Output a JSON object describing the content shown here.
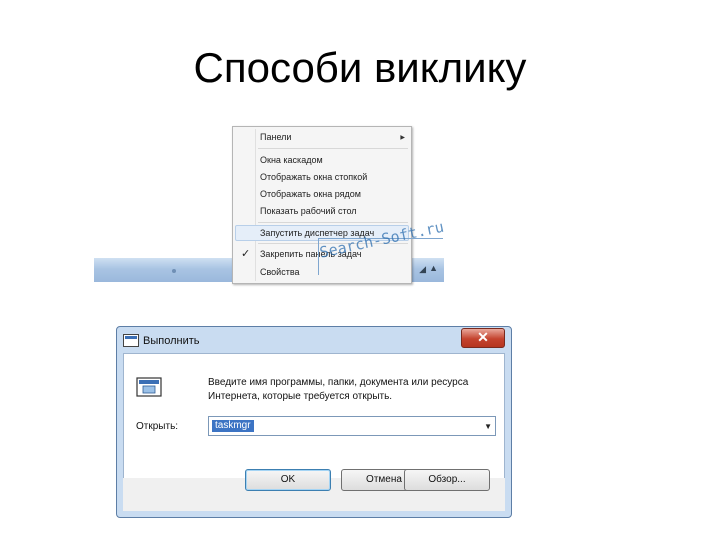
{
  "slide": {
    "title": "Способи виклику"
  },
  "context_menu": {
    "items": [
      {
        "label": "Панели",
        "has_submenu": true
      },
      {
        "label": "Окна каскадом"
      },
      {
        "label": "Отображать окна стопкой"
      },
      {
        "label": "Отображать окна рядом"
      },
      {
        "label": "Показать рабочий стол"
      },
      {
        "label": "Запустить диспетчер задач",
        "highlighted": true
      },
      {
        "label": "Закрепить панель задач",
        "checked": true
      },
      {
        "label": "Свойства"
      }
    ],
    "watermark": "Search-Soft.ru"
  },
  "run_dialog": {
    "title": "Выполнить",
    "instructions": "Введите имя программы, папки, документа или ресурса Интернета, которые требуется открыть.",
    "open_label": "Открыть:",
    "command_value": "taskmgr",
    "buttons": {
      "ok": "OK",
      "cancel": "Отмена",
      "browse": "Обзор..."
    },
    "close_glyph": "✕"
  },
  "colors": {
    "taskbar": "#a9c4e3",
    "dialog_frame": "#c9dcf1",
    "close_button": "#c4432e",
    "selection": "#3c74c4"
  }
}
